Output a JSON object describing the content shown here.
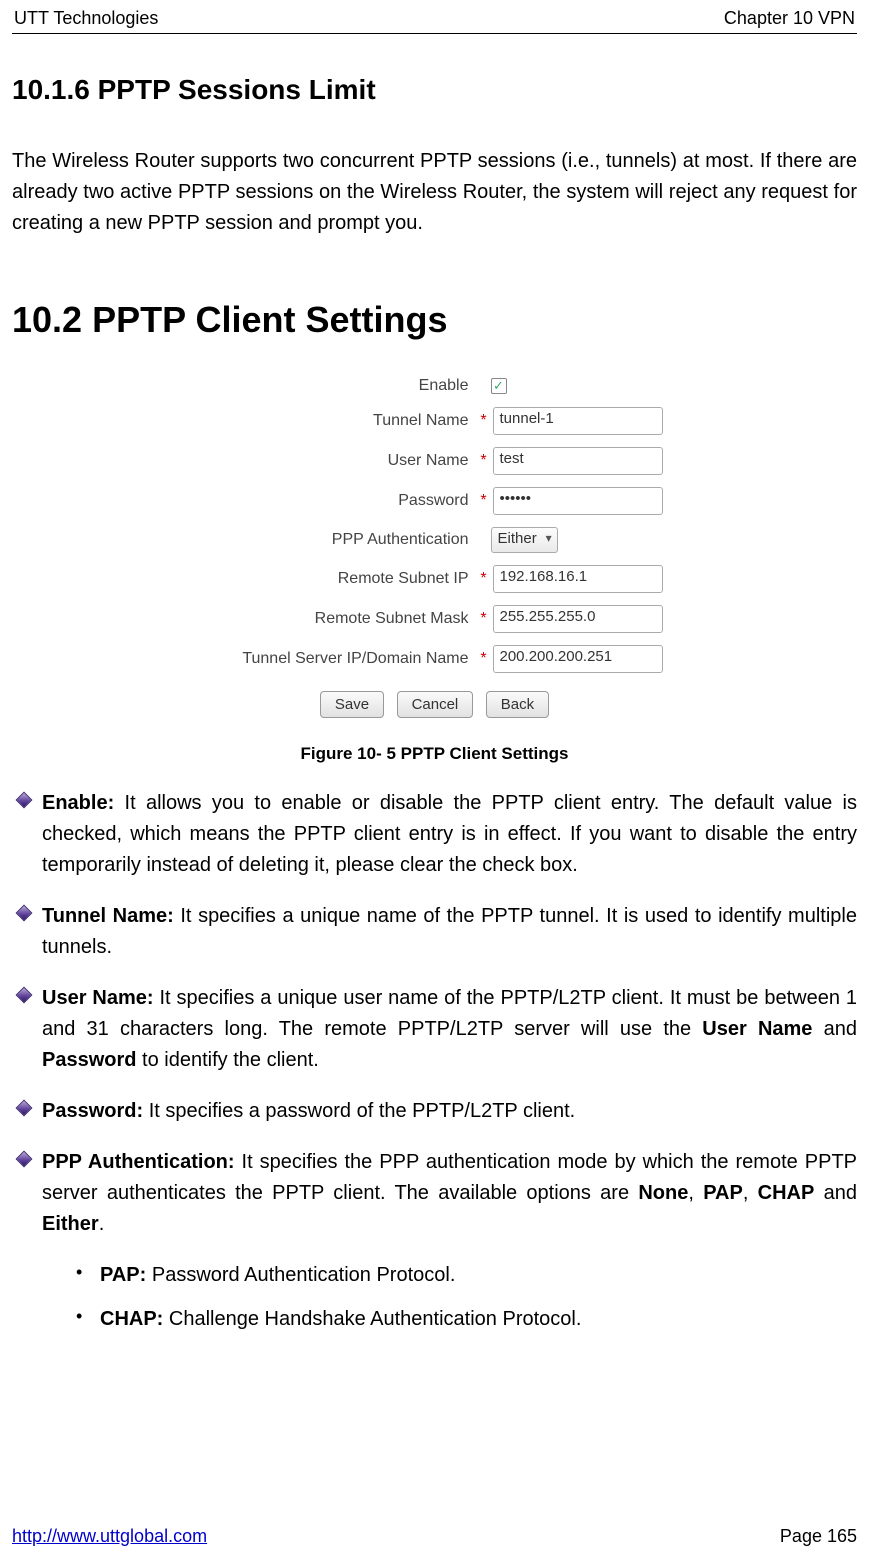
{
  "header": {
    "left": "UTT Technologies",
    "right": "Chapter 10 VPN"
  },
  "section_10_1_6": {
    "heading": "10.1.6  PPTP Sessions Limit",
    "body": "The Wireless Router supports two concurrent PPTP sessions (i.e., tunnels) at most. If there are already two active PPTP sessions on the Wireless Router, the system will reject any request for creating a new PPTP session and prompt you."
  },
  "section_10_2": {
    "heading": "10.2   PPTP Client Settings"
  },
  "form": {
    "labels": {
      "enable": "Enable",
      "tunnel_name": "Tunnel Name",
      "user_name": "User Name",
      "password": "Password",
      "ppp_auth": "PPP Authentication",
      "remote_subnet_ip": "Remote Subnet IP",
      "remote_subnet_mask": "Remote Subnet Mask",
      "tunnel_server": "Tunnel Server IP/Domain Name"
    },
    "values": {
      "enable_checked": "✓",
      "tunnel_name": "tunnel-1",
      "user_name": "test",
      "password": "••••••",
      "ppp_auth": "Either",
      "remote_subnet_ip": "192.168.16.1",
      "remote_subnet_mask": "255.255.255.0",
      "tunnel_server": "200.200.200.251"
    },
    "buttons": {
      "save": "Save",
      "cancel": "Cancel",
      "back": "Back"
    },
    "required_marker": "*"
  },
  "figure_caption": "Figure 10- 5 PPTP Client Settings",
  "bullets": {
    "enable": {
      "term": "Enable:",
      "rest": " It allows you to enable or disable the PPTP client entry. The default value is checked, which means the PPTP client entry is in effect. If you want to disable the entry temporarily instead of deleting it, please clear the check box."
    },
    "tunnel_name": {
      "term": "Tunnel Name:",
      "rest": " It specifies a unique name of the PPTP tunnel. It is used to identify multiple tunnels."
    },
    "user_name": {
      "pre": " It specifies a unique user name of the PPTP/L2TP client. It must be between 1 and 31 characters long. The remote PPTP/L2TP server will use the ",
      "term": "User Name:",
      "bold1": "User Name",
      "mid": " and ",
      "bold2": "Password",
      "post": " to identify the client."
    },
    "password": {
      "term": "Password:",
      "rest": " It specifies a password of the PPTP/L2TP client."
    },
    "ppp_auth": {
      "term": "PPP Authentication:",
      "pre": " It specifies the PPP authentication mode by which the remote PPTP server authenticates the PPTP client. The available options are ",
      "b1": "None",
      "s1": ", ",
      "b2": "PAP",
      "s2": ", ",
      "b3": "CHAP",
      "s3": " and ",
      "b4": "Either",
      "post": "."
    }
  },
  "sub_bullets": {
    "pap": {
      "term": "PAP:",
      "rest": " Password Authentication Protocol."
    },
    "chap": {
      "term": "CHAP:",
      "rest": " Challenge Handshake Authentication Protocol."
    }
  },
  "footer": {
    "link": "http://www.uttglobal.com",
    "page": "Page 165"
  }
}
